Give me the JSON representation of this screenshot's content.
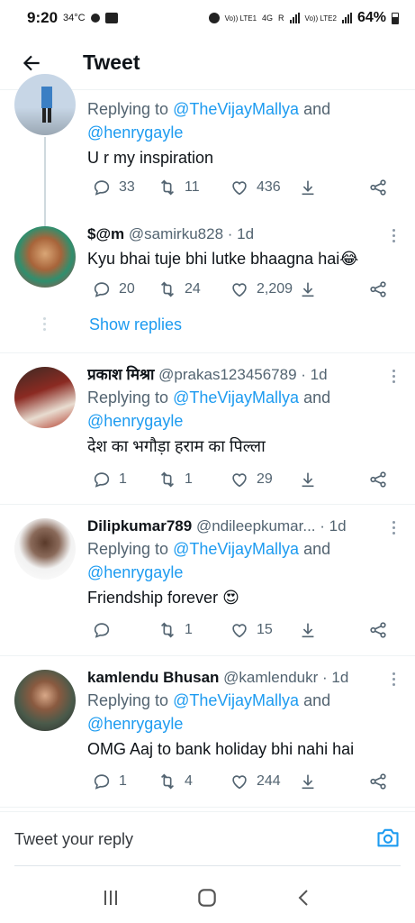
{
  "status_bar": {
    "time": "9:20",
    "temp": "34°C",
    "battery": "64%",
    "net_a": "Vo)) LTE1",
    "net_b": "4G",
    "net_c": "R",
    "net_d": "Vo)) LTE2"
  },
  "header": {
    "title": "Tweet"
  },
  "tweets": [
    {
      "name": "",
      "handle": "",
      "time": "",
      "replying_prefix": "Replying to ",
      "mention_1": "@TheVijayMallya",
      "and": " and",
      "mention_2": "@henrygayle",
      "text": "U r my inspiration",
      "replies": "33",
      "retweets": "11",
      "likes": "436"
    },
    {
      "name": "$@m",
      "handle": "@samirku828",
      "time": "· 1d",
      "text": "Kyu bhai tuje bhi lutke bhaagna hai😂",
      "replies": "20",
      "retweets": "24",
      "likes": "2,209",
      "show_replies": "Show replies"
    },
    {
      "name": "प्रकाश मिश्रा",
      "handle": "@prakas123456789",
      "time": "· 1d",
      "replying_prefix": "Replying to ",
      "mention_1": "@TheVijayMallya",
      "and": " and",
      "mention_2": "@henrygayle",
      "text": "देश का भगौड़ा हराम का पिल्ला",
      "replies": "1",
      "retweets": "1",
      "likes": "29"
    },
    {
      "name": "Dilipkumar789",
      "handle": "@ndileepkumar...",
      "time": "· 1d",
      "replying_prefix": "Replying to ",
      "mention_1": "@TheVijayMallya",
      "and": " and",
      "mention_2": "@henrygayle",
      "text": "Friendship forever 😍",
      "replies": "",
      "retweets": "1",
      "likes": "15"
    },
    {
      "name": "kamlendu Bhusan",
      "handle": "@kamlendukr",
      "time": "· 1d",
      "replying_prefix": "Replying to ",
      "mention_1": "@TheVijayMallya",
      "and": " and",
      "mention_2": "@henrygayle",
      "text": "OMG Aaj to bank holiday bhi nahi hai",
      "replies": "1",
      "retweets": "4",
      "likes": "244"
    }
  ],
  "reply_bar": {
    "placeholder": "Tweet your reply"
  },
  "colors": {
    "accent": "#1d9bf0",
    "muted": "#536471",
    "text": "#0f1419"
  },
  "icons": [
    "back-arrow-icon",
    "reply-icon",
    "retweet-icon",
    "like-icon",
    "share-icon",
    "camera-icon",
    "more-icon",
    "recent-apps-icon",
    "home-icon",
    "back-nav-icon"
  ]
}
